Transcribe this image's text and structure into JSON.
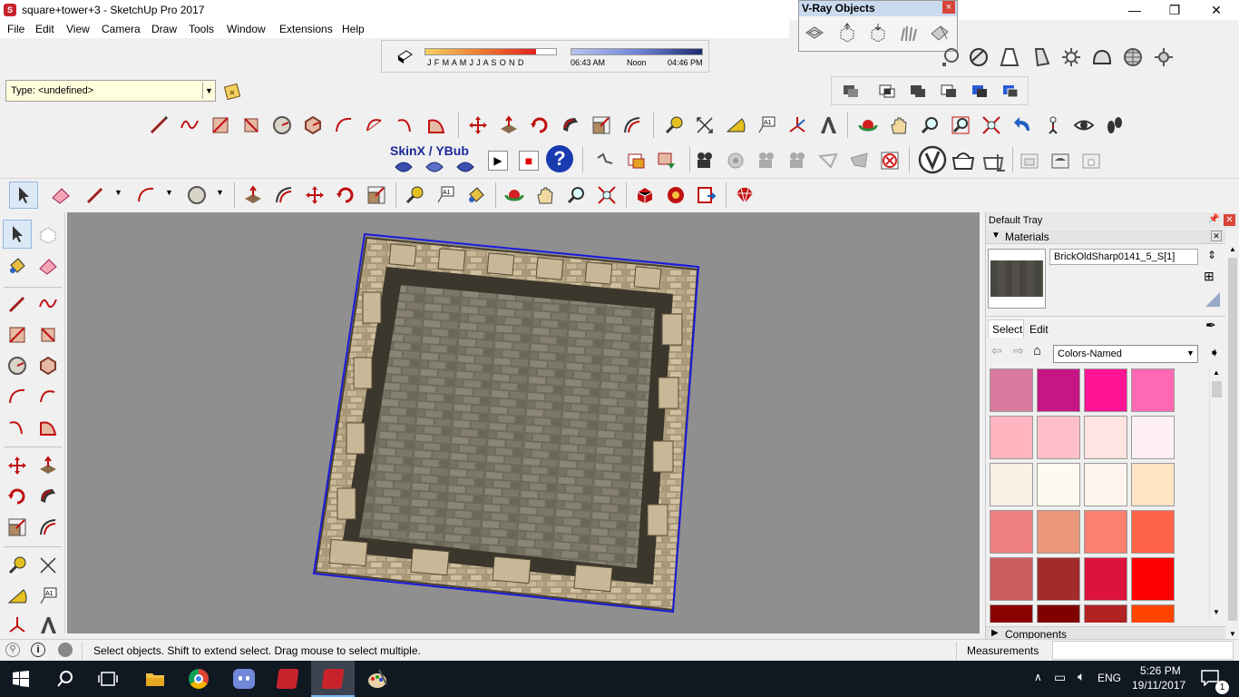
{
  "window": {
    "title": "square+tower+3 - SketchUp Pro 2017",
    "minimize_glyph": "—",
    "restore_glyph": "❐",
    "close_glyph": "✕"
  },
  "menu": {
    "items": [
      "File",
      "Edit",
      "View",
      "Camera",
      "Draw",
      "Tools",
      "Window",
      "Extensions",
      "Help"
    ]
  },
  "vray_panel": {
    "title": "V-Ray Objects",
    "close_glyph": "×"
  },
  "shadow_toolbar": {
    "months": "J F M A M J J A S O N D",
    "time_start": "06:43 AM",
    "time_mid": "Noon",
    "time_end": "04:46 PM",
    "month_fill_pct": 85,
    "time_fill_pct": 100
  },
  "type_selector": {
    "value": "Type: <undefined>"
  },
  "skinx": {
    "label": "SkinX / YBub",
    "play_glyph": "▶",
    "stop_glyph": "■",
    "help_glyph": "?"
  },
  "tray": {
    "title": "Default Tray",
    "materials_label": "Materials",
    "material_name": "BrickOldSharp0141_5_S[1]",
    "tab_select": "Select",
    "tab_edit": "Edit",
    "library": "Colors-Named",
    "components_label": "Components",
    "swatches": [
      [
        "#d8799e",
        "#c71585",
        "#ff1493",
        "#ff69b4"
      ],
      [
        "#ffb6c1",
        "#ffc0cb",
        "#ffe4e1",
        "#fff0f5"
      ],
      [
        "#faf0e6",
        "#fffaf0",
        "#fff5ee",
        "#ffe4c4"
      ],
      [
        "#f08080",
        "#e9967a",
        "#fa8072",
        "#ff6347"
      ],
      [
        "#cd5c5c",
        "#a52a2a",
        "#dc143c",
        "#ff0000"
      ],
      [
        "#8b0000",
        "#800000",
        "#b22222",
        "#ff4500"
      ]
    ]
  },
  "status": {
    "message": "Select objects. Shift to extend select. Drag mouse to select multiple.",
    "measurements_label": "Measurements",
    "measurements_value": ""
  },
  "taskbar": {
    "language": "ENG",
    "time": "5:26 PM",
    "date": "19/11/2017",
    "notification_count": "1"
  },
  "colors": {
    "selection": "#1a1adc",
    "viewport_bg": "#8f8f8f"
  }
}
